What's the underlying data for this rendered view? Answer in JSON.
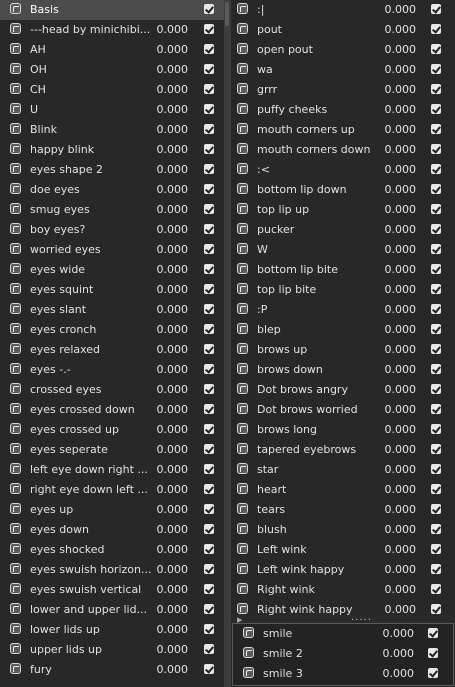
{
  "left_list": [
    {
      "name": "Basis",
      "value": "",
      "checked": true
    },
    {
      "name": "---head by minichibi...",
      "value": "0.000",
      "checked": true
    },
    {
      "name": "AH",
      "value": "0.000",
      "checked": true
    },
    {
      "name": "OH",
      "value": "0.000",
      "checked": true
    },
    {
      "name": "CH",
      "value": "0.000",
      "checked": true
    },
    {
      "name": "U",
      "value": "0.000",
      "checked": true
    },
    {
      "name": "Blink",
      "value": "0.000",
      "checked": true
    },
    {
      "name": "happy blink",
      "value": "0.000",
      "checked": true
    },
    {
      "name": "eyes shape 2",
      "value": "0.000",
      "checked": true
    },
    {
      "name": "doe eyes",
      "value": "0.000",
      "checked": true
    },
    {
      "name": "smug eyes",
      "value": "0.000",
      "checked": true
    },
    {
      "name": "boy eyes?",
      "value": "0.000",
      "checked": true
    },
    {
      "name": "worried eyes",
      "value": "0.000",
      "checked": true
    },
    {
      "name": "eyes wide",
      "value": "0.000",
      "checked": true
    },
    {
      "name": "eyes squint",
      "value": "0.000",
      "checked": true
    },
    {
      "name": "eyes slant",
      "value": "0.000",
      "checked": true
    },
    {
      "name": "eyes cronch",
      "value": "0.000",
      "checked": true
    },
    {
      "name": "eyes relaxed",
      "value": "0.000",
      "checked": true
    },
    {
      "name": "eyes -.-",
      "value": "0.000",
      "checked": true
    },
    {
      "name": "crossed eyes",
      "value": "0.000",
      "checked": true
    },
    {
      "name": "eyes crossed down",
      "value": "0.000",
      "checked": true
    },
    {
      "name": "eyes crossed up",
      "value": "0.000",
      "checked": true
    },
    {
      "name": "eyes seperate",
      "value": "0.000",
      "checked": true
    },
    {
      "name": "left eye down right ...",
      "value": "0.000",
      "checked": true
    },
    {
      "name": "right eye down left ...",
      "value": "0.000",
      "checked": true
    },
    {
      "name": "eyes up",
      "value": "0.000",
      "checked": true
    },
    {
      "name": "eyes down",
      "value": "0.000",
      "checked": true
    },
    {
      "name": "eyes shocked",
      "value": "0.000",
      "checked": true
    },
    {
      "name": "eyes swuish horizon...",
      "value": "0.000",
      "checked": true
    },
    {
      "name": "eyes swuish vertical",
      "value": "0.000",
      "checked": true
    },
    {
      "name": "lower and upper lid...",
      "value": "0.000",
      "checked": true
    },
    {
      "name": "lower lids up",
      "value": "0.000",
      "checked": true
    },
    {
      "name": "upper lids up",
      "value": "0.000",
      "checked": true
    },
    {
      "name": "fury",
      "value": "0.000",
      "checked": true
    }
  ],
  "right_list": [
    {
      "name": ":|",
      "value": "0.000",
      "checked": true
    },
    {
      "name": "pout",
      "value": "0.000",
      "checked": true
    },
    {
      "name": "open pout",
      "value": "0.000",
      "checked": true
    },
    {
      "name": "wa",
      "value": "0.000",
      "checked": true
    },
    {
      "name": "grrr",
      "value": "0.000",
      "checked": true
    },
    {
      "name": "puffy cheeks",
      "value": "0.000",
      "checked": true
    },
    {
      "name": "mouth corners up",
      "value": "0.000",
      "checked": true
    },
    {
      "name": "mouth corners down",
      "value": "0.000",
      "checked": true
    },
    {
      "name": ":<",
      "value": "0.000",
      "checked": true
    },
    {
      "name": "bottom lip down",
      "value": "0.000",
      "checked": true
    },
    {
      "name": "top lip up",
      "value": "0.000",
      "checked": true
    },
    {
      "name": "pucker",
      "value": "0.000",
      "checked": true
    },
    {
      "name": "W",
      "value": "0.000",
      "checked": true
    },
    {
      "name": "bottom lip bite",
      "value": "0.000",
      "checked": true
    },
    {
      "name": "top lip bite",
      "value": "0.000",
      "checked": true
    },
    {
      "name": ":P",
      "value": "0.000",
      "checked": true
    },
    {
      "name": "blep",
      "value": "0.000",
      "checked": true
    },
    {
      "name": "brows up",
      "value": "0.000",
      "checked": true
    },
    {
      "name": "brows down",
      "value": "0.000",
      "checked": true
    },
    {
      "name": " Dot brows angry",
      "value": "0.000",
      "checked": true
    },
    {
      "name": "Dot brows worried",
      "value": "0.000",
      "checked": true
    },
    {
      "name": "brows long",
      "value": "0.000",
      "checked": true
    },
    {
      "name": "tapered eyebrows",
      "value": "0.000",
      "checked": true
    },
    {
      "name": "star",
      "value": "0.000",
      "checked": true
    },
    {
      "name": "heart",
      "value": "0.000",
      "checked": true
    },
    {
      "name": "tears",
      "value": "0.000",
      "checked": true
    },
    {
      "name": "blush",
      "value": "0.000",
      "checked": true
    },
    {
      "name": "Left wink",
      "value": "0.000",
      "checked": true
    },
    {
      "name": "Left wink happy",
      "value": "0.000",
      "checked": true
    },
    {
      "name": "Right wink",
      "value": "0.000",
      "checked": true
    },
    {
      "name": "Right wink happy",
      "value": "0.000",
      "checked": true
    }
  ],
  "splitter": {
    "arrow": "▶",
    "dots": "....."
  },
  "sub_list": [
    {
      "name": "smile",
      "value": "0.000",
      "checked": true
    },
    {
      "name": "smile 2",
      "value": "0.000",
      "checked": true
    },
    {
      "name": "smile 3",
      "value": "0.000",
      "checked": true
    }
  ]
}
